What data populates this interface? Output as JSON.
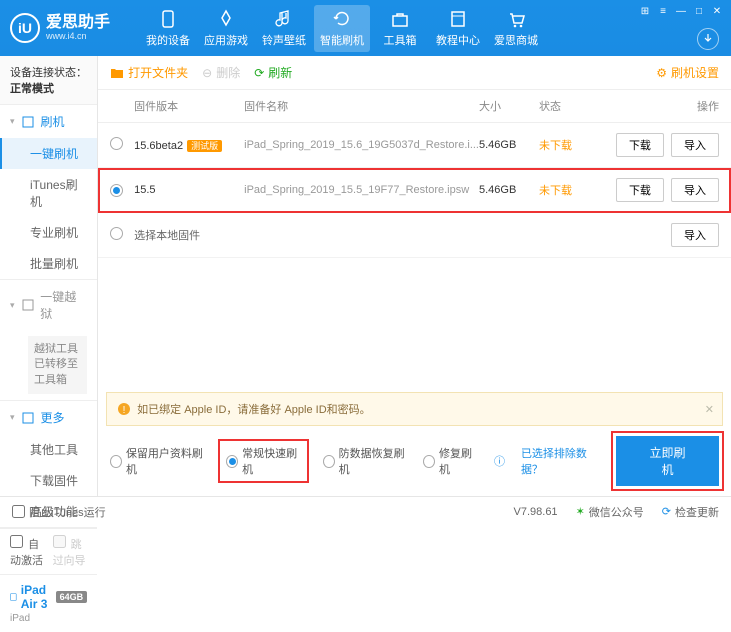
{
  "brand": {
    "name": "爱思助手",
    "url": "www.i4.cn",
    "logo_letter": "iU"
  },
  "window_ctrls": [
    "⊞",
    "≡",
    "—",
    "□",
    "✕"
  ],
  "nav": [
    {
      "label": "我的设备",
      "icon": "phone-icon"
    },
    {
      "label": "应用游戏",
      "icon": "apps-icon"
    },
    {
      "label": "铃声壁纸",
      "icon": "music-icon"
    },
    {
      "label": "智能刷机",
      "icon": "refresh-icon",
      "active": true
    },
    {
      "label": "工具箱",
      "icon": "toolbox-icon"
    },
    {
      "label": "教程中心",
      "icon": "book-icon"
    },
    {
      "label": "爱思商城",
      "icon": "cart-icon"
    }
  ],
  "sidebar": {
    "status_label": "设备连接状态：",
    "status_value": "正常模式",
    "groups": [
      {
        "title": "刷机",
        "icon": "flash-icon",
        "items": [
          "一键刷机",
          "iTunes刷机",
          "专业刷机",
          "批量刷机"
        ],
        "active_index": 0
      },
      {
        "title": "一键越狱",
        "icon": "unlock-icon",
        "gray": true,
        "note": "越狱工具已转移至工具箱"
      },
      {
        "title": "更多",
        "icon": "more-icon",
        "items": [
          "其他工具",
          "下载固件",
          "高级功能"
        ]
      }
    ],
    "auto_activate": "自动激活",
    "skip_guide": "跳过向导",
    "device": {
      "name": "iPad Air 3",
      "capacity": "64GB",
      "type": "iPad"
    }
  },
  "toolbar": {
    "open_folder": "打开文件夹",
    "delete": "删除",
    "refresh": "刷新",
    "settings": "刷机设置"
  },
  "table": {
    "headers": {
      "version": "固件版本",
      "name": "固件名称",
      "size": "大小",
      "status": "状态",
      "ops": "操作"
    },
    "rows": [
      {
        "version": "15.6beta2",
        "beta": "测试版",
        "name": "iPad_Spring_2019_15.6_19G5037d_Restore.i...",
        "size": "5.46GB",
        "status": "未下载",
        "selected": false
      },
      {
        "version": "15.5",
        "name": "iPad_Spring_2019_15.5_19F77_Restore.ipsw",
        "size": "5.46GB",
        "status": "未下载",
        "selected": true
      }
    ],
    "local_row": "选择本地固件",
    "btn_download": "下载",
    "btn_import": "导入"
  },
  "warning": {
    "text": "如已绑定 Apple ID，请准备好 Apple ID和密码。"
  },
  "options": {
    "keep_data": "保留用户资料刷机",
    "normal": "常规快速刷机",
    "anti_recovery": "防数据恢复刷机",
    "repair": "修复刷机",
    "exclude_link": "已选择排除数据？",
    "flash_btn": "立即刷机"
  },
  "statusbar": {
    "block_itunes": "阻止iTunes运行",
    "version": "V7.98.61",
    "wechat": "微信公众号",
    "check_update": "检查更新"
  }
}
